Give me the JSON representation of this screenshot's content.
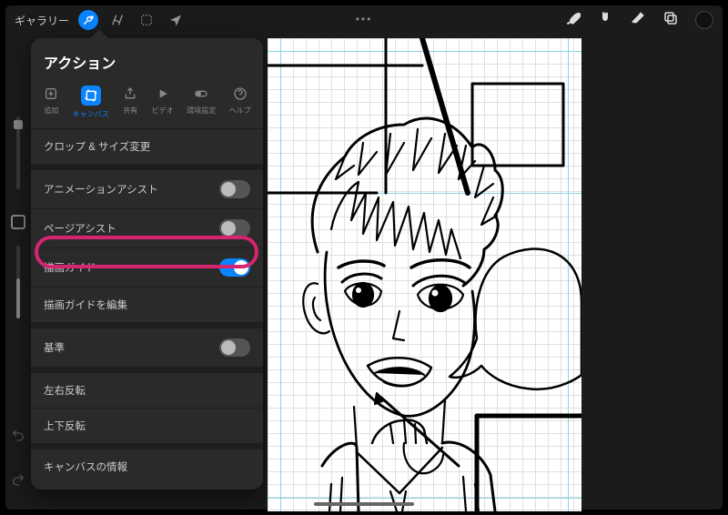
{
  "topbar": {
    "gallery": "ギャラリー",
    "ellipsis": "•••"
  },
  "panel": {
    "title": "アクション",
    "tabs": {
      "add": "追加",
      "canvas": "キャンバス",
      "share": "共有",
      "video": "ビデオ",
      "prefs": "環境設定",
      "help": "ヘルプ"
    },
    "rows": {
      "crop": "クロップ & サイズ変更",
      "anim_assist": "アニメーションアシスト",
      "page_assist": "ページアシスト",
      "draw_guide": "描画ガイド",
      "edit_guide": "描画ガイドを編集",
      "reference": "基準",
      "flip_h": "左右反転",
      "flip_v": "上下反転",
      "canvas_info": "キャンバスの情報"
    }
  },
  "colors": {
    "accent": "#0a84ff",
    "highlight": "#d6246f"
  }
}
